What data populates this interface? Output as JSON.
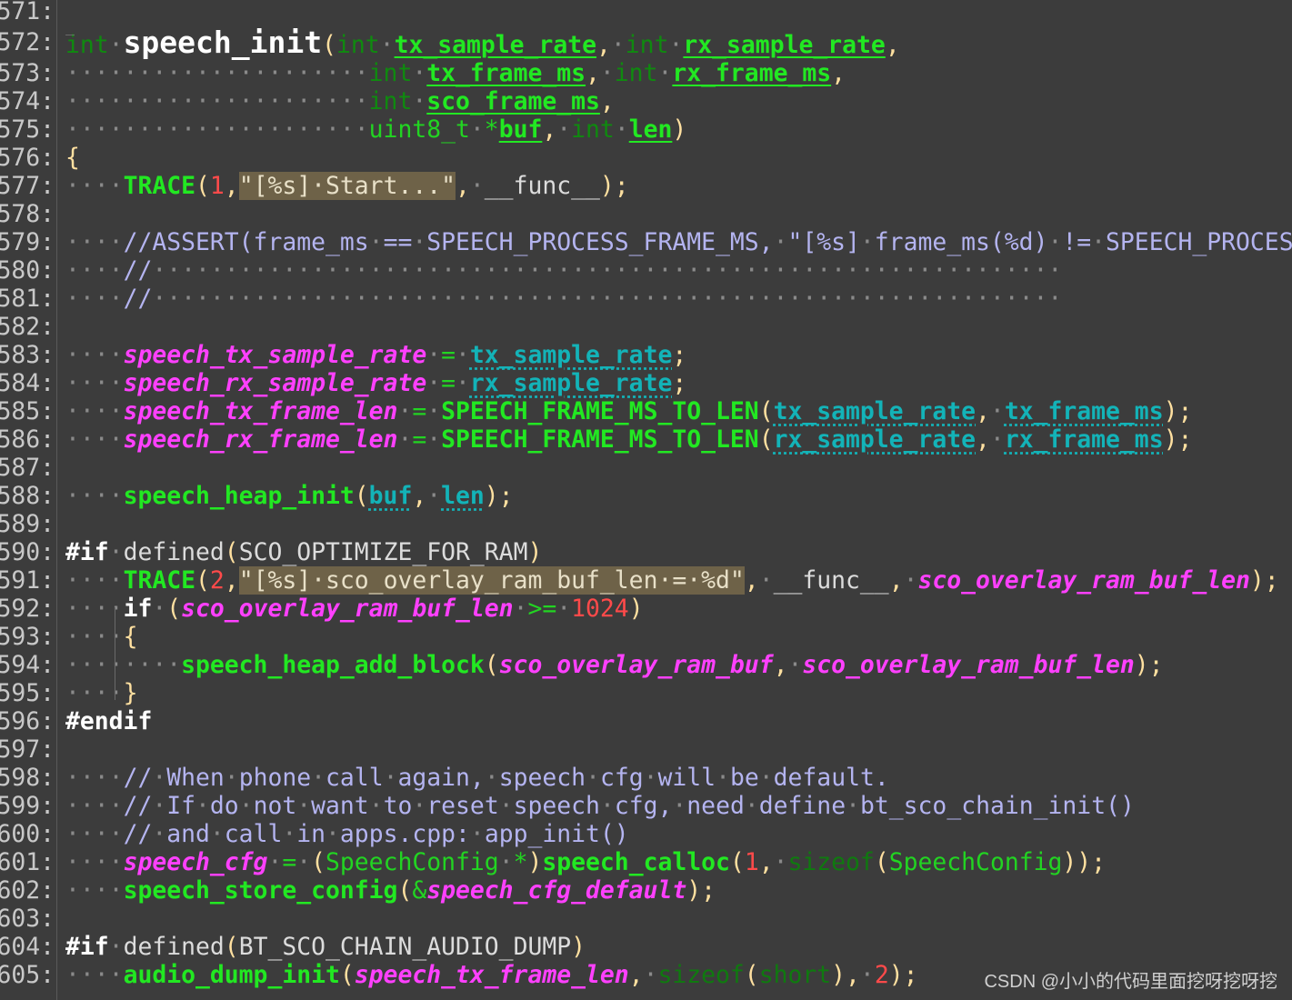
{
  "editor": {
    "lines": [
      {
        "n": "571:",
        "tokens": []
      },
      {
        "n": "572:",
        "tokens": [
          [
            "kw",
            "int"
          ],
          [
            "ws",
            "·"
          ],
          [
            "fnbig",
            "speech_init"
          ],
          [
            "punc",
            "("
          ],
          [
            "kw",
            "int"
          ],
          [
            "ws",
            "·"
          ],
          [
            "param",
            "tx_sample_rate"
          ],
          [
            "punc",
            ","
          ],
          [
            "ws",
            "·"
          ],
          [
            "kw",
            "int"
          ],
          [
            "ws",
            "·"
          ],
          [
            "param",
            "rx_sample_rate"
          ],
          [
            "punc",
            ","
          ]
        ]
      },
      {
        "n": "573:",
        "tokens": [
          [
            "ws",
            "·····················"
          ],
          [
            "kw",
            "int"
          ],
          [
            "ws",
            "·"
          ],
          [
            "param",
            "tx_frame_ms"
          ],
          [
            "punc",
            ","
          ],
          [
            "ws",
            "·"
          ],
          [
            "kw",
            "int"
          ],
          [
            "ws",
            "·"
          ],
          [
            "param",
            "rx_frame_ms"
          ],
          [
            "punc",
            ","
          ]
        ]
      },
      {
        "n": "574:",
        "tokens": [
          [
            "ws",
            "·····················"
          ],
          [
            "kw",
            "int"
          ],
          [
            "ws",
            "·"
          ],
          [
            "param",
            "sco_frame_ms"
          ],
          [
            "punc",
            ","
          ]
        ]
      },
      {
        "n": "575:",
        "tokens": [
          [
            "ws",
            "·····················"
          ],
          [
            "type",
            "uint8_t"
          ],
          [
            "ws",
            "·"
          ],
          [
            "op",
            "*"
          ],
          [
            "param",
            "buf"
          ],
          [
            "punc",
            ","
          ],
          [
            "ws",
            "·"
          ],
          [
            "kw",
            "int"
          ],
          [
            "ws",
            "·"
          ],
          [
            "param",
            "len"
          ],
          [
            "punc",
            ")"
          ]
        ]
      },
      {
        "n": "576:",
        "tokens": [
          [
            "punc",
            "{"
          ]
        ]
      },
      {
        "n": "577:",
        "tokens": [
          [
            "ws",
            "····"
          ],
          [
            "macro",
            "TRACE"
          ],
          [
            "punc",
            "("
          ],
          [
            "num",
            "1"
          ],
          [
            "punc",
            ","
          ],
          [
            "str",
            "\"[%s]·Start...\""
          ],
          [
            "punc",
            ","
          ],
          [
            "ws",
            "·"
          ],
          [
            "plain",
            "__func__"
          ],
          [
            "punc",
            ");"
          ]
        ]
      },
      {
        "n": "578:",
        "tokens": []
      },
      {
        "n": "579:",
        "tokens": [
          [
            "ws",
            "····"
          ],
          [
            "comment",
            "//ASSERT(frame_ms"
          ],
          [
            "ws",
            "·"
          ],
          [
            "comment",
            "=="
          ],
          [
            "ws",
            "·"
          ],
          [
            "comment",
            "SPEECH_PROCESS_FRAME_MS,"
          ],
          [
            "ws",
            "·"
          ],
          [
            "comment",
            "\"[%s]"
          ],
          [
            "ws",
            "·"
          ],
          [
            "comment",
            "frame_ms(%d)"
          ],
          [
            "ws",
            "·"
          ],
          [
            "comment",
            "!="
          ],
          [
            "ws",
            "·"
          ],
          [
            "comment",
            "SPEECH_PROCESS"
          ]
        ]
      },
      {
        "n": "580:",
        "tokens": [
          [
            "ws",
            "····"
          ],
          [
            "comment",
            "//"
          ],
          [
            "ws",
            "·······························································"
          ]
        ]
      },
      {
        "n": "581:",
        "tokens": [
          [
            "ws",
            "····"
          ],
          [
            "comment",
            "//"
          ],
          [
            "ws",
            "·······························································"
          ]
        ]
      },
      {
        "n": "582:",
        "tokens": []
      },
      {
        "n": "583:",
        "tokens": [
          [
            "ws",
            "····"
          ],
          [
            "global",
            "speech_tx_sample_rate"
          ],
          [
            "ws",
            "·"
          ],
          [
            "op",
            "="
          ],
          [
            "ws",
            "·"
          ],
          [
            "arg",
            "tx_sample_rate"
          ],
          [
            "punc",
            ";"
          ]
        ]
      },
      {
        "n": "584:",
        "tokens": [
          [
            "ws",
            "····"
          ],
          [
            "global",
            "speech_rx_sample_rate"
          ],
          [
            "ws",
            "·"
          ],
          [
            "op",
            "="
          ],
          [
            "ws",
            "·"
          ],
          [
            "arg",
            "rx_sample_rate"
          ],
          [
            "punc",
            ";"
          ]
        ]
      },
      {
        "n": "585:",
        "tokens": [
          [
            "ws",
            "····"
          ],
          [
            "global",
            "speech_tx_frame_len"
          ],
          [
            "ws",
            "·"
          ],
          [
            "op",
            "="
          ],
          [
            "ws",
            "·"
          ],
          [
            "macro",
            "SPEECH_FRAME_MS_TO_LEN"
          ],
          [
            "punc",
            "("
          ],
          [
            "arg",
            "tx_sample_rate"
          ],
          [
            "punc",
            ","
          ],
          [
            "ws",
            "·"
          ],
          [
            "arg",
            "tx_frame_ms"
          ],
          [
            "punc",
            ");"
          ]
        ]
      },
      {
        "n": "586:",
        "tokens": [
          [
            "ws",
            "····"
          ],
          [
            "global",
            "speech_rx_frame_len"
          ],
          [
            "ws",
            "·"
          ],
          [
            "op",
            "="
          ],
          [
            "ws",
            "·"
          ],
          [
            "macro",
            "SPEECH_FRAME_MS_TO_LEN"
          ],
          [
            "punc",
            "("
          ],
          [
            "arg",
            "rx_sample_rate"
          ],
          [
            "punc",
            ","
          ],
          [
            "ws",
            "·"
          ],
          [
            "arg",
            "rx_frame_ms"
          ],
          [
            "punc",
            ");"
          ]
        ]
      },
      {
        "n": "587:",
        "tokens": []
      },
      {
        "n": "588:",
        "tokens": [
          [
            "ws",
            "····"
          ],
          [
            "fn",
            "speech_heap_init"
          ],
          [
            "punc",
            "("
          ],
          [
            "arg",
            "buf"
          ],
          [
            "punc",
            ","
          ],
          [
            "ws",
            "·"
          ],
          [
            "arg",
            "len"
          ],
          [
            "punc",
            ");"
          ]
        ]
      },
      {
        "n": "589:",
        "tokens": []
      },
      {
        "n": "590:",
        "tokens": [
          [
            "pp",
            "#if"
          ],
          [
            "ws",
            "·"
          ],
          [
            "plain",
            "defined"
          ],
          [
            "punc",
            "("
          ],
          [
            "plain",
            "SCO_OPTIMIZE_FOR_RAM"
          ],
          [
            "punc",
            ")"
          ]
        ]
      },
      {
        "n": "591:",
        "tokens": [
          [
            "ws",
            "····"
          ],
          [
            "macro",
            "TRACE"
          ],
          [
            "punc",
            "("
          ],
          [
            "num",
            "2"
          ],
          [
            "punc",
            ","
          ],
          [
            "str",
            "\"[%s]·sco_overlay_ram_buf_len·=·%d\""
          ],
          [
            "punc",
            ","
          ],
          [
            "ws",
            "·"
          ],
          [
            "plain",
            "__func__"
          ],
          [
            "punc",
            ","
          ],
          [
            "ws",
            "·"
          ],
          [
            "global",
            "sco_overlay_ram_buf_len"
          ],
          [
            "punc",
            ");"
          ]
        ]
      },
      {
        "n": "592:",
        "tokens": [
          [
            "ws",
            "····"
          ],
          [
            "pp",
            "if"
          ],
          [
            "ws",
            "·"
          ],
          [
            "punc",
            "("
          ],
          [
            "global",
            "sco_overlay_ram_buf_len"
          ],
          [
            "ws",
            "·"
          ],
          [
            "op",
            ">="
          ],
          [
            "ws",
            "·"
          ],
          [
            "num",
            "1024"
          ],
          [
            "punc",
            ")"
          ]
        ]
      },
      {
        "n": "593:",
        "tokens": [
          [
            "ws",
            "····"
          ],
          [
            "punc",
            "{"
          ]
        ]
      },
      {
        "n": "594:",
        "tokens": [
          [
            "ws",
            "········"
          ],
          [
            "fn",
            "speech_heap_add_block"
          ],
          [
            "punc",
            "("
          ],
          [
            "global",
            "sco_overlay_ram_buf"
          ],
          [
            "punc",
            ","
          ],
          [
            "ws",
            "·"
          ],
          [
            "global",
            "sco_overlay_ram_buf_len"
          ],
          [
            "punc",
            ");"
          ]
        ]
      },
      {
        "n": "595:",
        "tokens": [
          [
            "ws",
            "····"
          ],
          [
            "punc",
            "}"
          ]
        ]
      },
      {
        "n": "596:",
        "tokens": [
          [
            "pp",
            "#endif"
          ]
        ]
      },
      {
        "n": "597:",
        "tokens": []
      },
      {
        "n": "598:",
        "tokens": [
          [
            "ws",
            "····"
          ],
          [
            "comment",
            "//"
          ],
          [
            "ws",
            "·"
          ],
          [
            "comment",
            "When"
          ],
          [
            "ws",
            "·"
          ],
          [
            "comment",
            "phone"
          ],
          [
            "ws",
            "·"
          ],
          [
            "comment",
            "call"
          ],
          [
            "ws",
            "·"
          ],
          [
            "comment",
            "again,"
          ],
          [
            "ws",
            "·"
          ],
          [
            "comment",
            "speech"
          ],
          [
            "ws",
            "·"
          ],
          [
            "comment",
            "cfg"
          ],
          [
            "ws",
            "·"
          ],
          [
            "comment",
            "will"
          ],
          [
            "ws",
            "·"
          ],
          [
            "comment",
            "be"
          ],
          [
            "ws",
            "·"
          ],
          [
            "comment",
            "default."
          ]
        ]
      },
      {
        "n": "599:",
        "tokens": [
          [
            "ws",
            "····"
          ],
          [
            "comment",
            "//"
          ],
          [
            "ws",
            "·"
          ],
          [
            "comment",
            "If"
          ],
          [
            "ws",
            "·"
          ],
          [
            "comment",
            "do"
          ],
          [
            "ws",
            "·"
          ],
          [
            "comment",
            "not"
          ],
          [
            "ws",
            "·"
          ],
          [
            "comment",
            "want"
          ],
          [
            "ws",
            "·"
          ],
          [
            "comment",
            "to"
          ],
          [
            "ws",
            "·"
          ],
          [
            "comment",
            "reset"
          ],
          [
            "ws",
            "·"
          ],
          [
            "comment",
            "speech"
          ],
          [
            "ws",
            "·"
          ],
          [
            "comment",
            "cfg,"
          ],
          [
            "ws",
            "·"
          ],
          [
            "comment",
            "need"
          ],
          [
            "ws",
            "·"
          ],
          [
            "comment",
            "define"
          ],
          [
            "ws",
            "·"
          ],
          [
            "comment",
            "bt_sco_chain_init()"
          ]
        ]
      },
      {
        "n": "600:",
        "tokens": [
          [
            "ws",
            "····"
          ],
          [
            "comment",
            "//"
          ],
          [
            "ws",
            "·"
          ],
          [
            "comment",
            "and"
          ],
          [
            "ws",
            "·"
          ],
          [
            "comment",
            "call"
          ],
          [
            "ws",
            "·"
          ],
          [
            "comment",
            "in"
          ],
          [
            "ws",
            "·"
          ],
          [
            "comment",
            "apps.cpp:"
          ],
          [
            "ws",
            "·"
          ],
          [
            "comment",
            "app_init()"
          ]
        ]
      },
      {
        "n": "601:",
        "tokens": [
          [
            "ws",
            "····"
          ],
          [
            "global",
            "speech_cfg"
          ],
          [
            "ws",
            "·"
          ],
          [
            "op",
            "="
          ],
          [
            "ws",
            "·"
          ],
          [
            "punc",
            "("
          ],
          [
            "type",
            "SpeechConfig"
          ],
          [
            "ws",
            "·"
          ],
          [
            "op",
            "*"
          ],
          [
            "punc",
            ")"
          ],
          [
            "fn",
            "speech_calloc"
          ],
          [
            "punc",
            "("
          ],
          [
            "num",
            "1"
          ],
          [
            "punc",
            ","
          ],
          [
            "ws",
            "·"
          ],
          [
            "dim",
            "sizeof"
          ],
          [
            "punc",
            "("
          ],
          [
            "type",
            "SpeechConfig"
          ],
          [
            "punc",
            "));"
          ]
        ]
      },
      {
        "n": "602:",
        "tokens": [
          [
            "ws",
            "····"
          ],
          [
            "fn",
            "speech_store_config"
          ],
          [
            "punc",
            "("
          ],
          [
            "op",
            "&"
          ],
          [
            "global",
            "speech_cfg_default"
          ],
          [
            "punc",
            ");"
          ]
        ]
      },
      {
        "n": "603:",
        "tokens": []
      },
      {
        "n": "604:",
        "tokens": [
          [
            "pp",
            "#if"
          ],
          [
            "ws",
            "·"
          ],
          [
            "plain",
            "defined"
          ],
          [
            "punc",
            "("
          ],
          [
            "plain",
            "BT_SCO_CHAIN_AUDIO_DUMP"
          ],
          [
            "punc",
            ")"
          ]
        ]
      },
      {
        "n": "605:",
        "tokens": [
          [
            "ws",
            "····"
          ],
          [
            "fn",
            "audio_dump_init"
          ],
          [
            "punc",
            "("
          ],
          [
            "global",
            "speech_tx_frame_len"
          ],
          [
            "punc",
            ","
          ],
          [
            "ws",
            "·"
          ],
          [
            "dim",
            "sizeof"
          ],
          [
            "punc",
            "("
          ],
          [
            "dim",
            "short"
          ],
          [
            "punc",
            "),"
          ],
          [
            "ws",
            "·"
          ],
          [
            "num",
            "2"
          ],
          [
            "punc",
            ");"
          ]
        ]
      }
    ]
  },
  "watermark": "CSDN @小小的代码里面挖呀挖呀挖",
  "colors": {
    "background": "#3c3c3c",
    "keyword": "#0f8a0f",
    "parameter": "#22e822",
    "global": "#ff40ff",
    "argument": "#13b3b8",
    "comment": "#b4b4f0",
    "number": "#ff4a4a",
    "string_bg": "#6e6248"
  }
}
